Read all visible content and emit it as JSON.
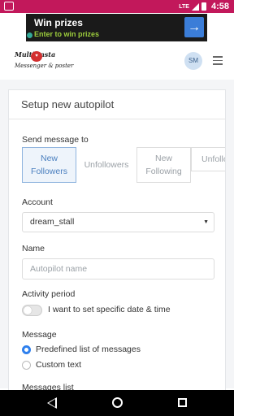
{
  "status_bar": {
    "lte": "LTE",
    "time": "4:58"
  },
  "ad": {
    "title": "Win prizes",
    "subtitle": "Enter to win prizes",
    "arrow": "→"
  },
  "header": {
    "logo_line1": "Multi   Insta",
    "logo_line2": "Messenger & poster",
    "avatar_initials": "SM",
    "menu_icon": "hamburger-icon"
  },
  "form": {
    "title": "Setup new autopilot",
    "send_message_label": "Send message to",
    "tabs": [
      {
        "label": "New\nFollowers",
        "active": true
      },
      {
        "label": "Unfollowers",
        "active": false
      },
      {
        "label": "New\nFollowing",
        "active": false
      },
      {
        "label": "Unfollowi",
        "active": false
      }
    ],
    "account_label": "Account",
    "account_value": "dream_stall",
    "name_label": "Name",
    "name_placeholder": "Autopilot name",
    "activity_label": "Activity period",
    "activity_toggle_text": "I want to set specific date & time",
    "message_label": "Message",
    "message_options": [
      {
        "label": "Predefined list of messages",
        "selected": true
      },
      {
        "label": "Custom text",
        "selected": false
      }
    ],
    "messages_list_label": "Messages list"
  },
  "colors": {
    "status_bar": "#c2185b",
    "accent": "#2f80ed",
    "tab_active": "#4a7fbf"
  }
}
